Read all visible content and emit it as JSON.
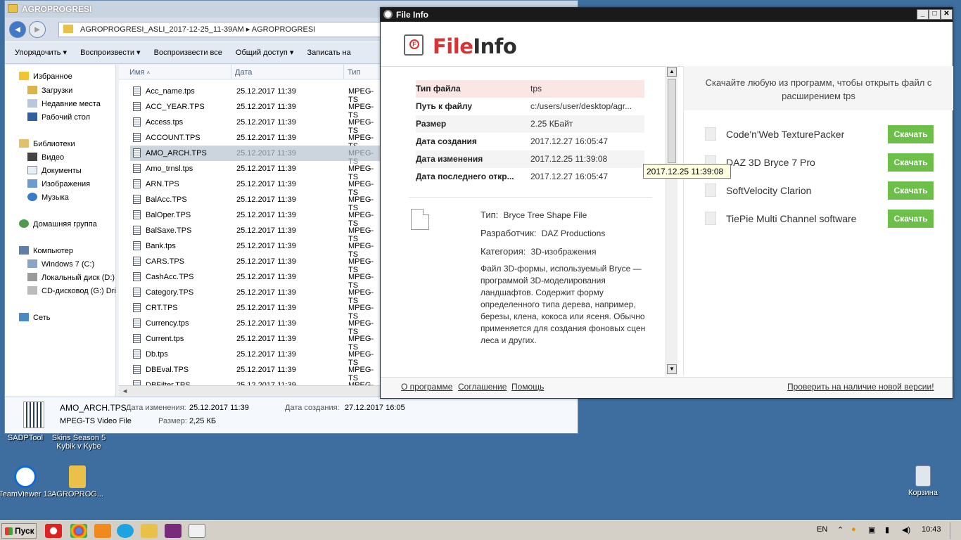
{
  "desktop": {
    "icons": [
      {
        "label": "SADPTool"
      },
      {
        "label": "Skins Season 5 Kybik v Kybe"
      },
      {
        "label": "TeamViewer 13"
      },
      {
        "label": "AGROPROG..."
      },
      {
        "label": "Корзина"
      }
    ]
  },
  "explorer": {
    "title": "AGROPROGRESI",
    "breadcrumb": "AGROPROGRESI_ASLI_2017-12-25_11-39AM  ▸  AGROPROGRESI",
    "toolbar": [
      "Упорядочить ▾",
      "Воспроизвести ▾",
      "Воспроизвести все",
      "Общий доступ ▾",
      "Записать на"
    ],
    "nav": {
      "favorites": "Избранное",
      "downloads": "Загрузки",
      "recent": "Недавние места",
      "desktop": "Рабочий стол",
      "libraries": "Библиотеки",
      "video": "Видео",
      "documents": "Документы",
      "images": "Изображения",
      "music": "Музыка",
      "homegroup": "Домашняя группа",
      "computer": "Компьютер",
      "drive_c": "Windows 7 (C:)",
      "drive_d": "Локальный диск (D:)",
      "drive_g": "CD-дисковод (G:) Dri",
      "network": "Сеть"
    },
    "columns": {
      "name": "Имя",
      "date": "Дата",
      "type": "Тип"
    },
    "files": [
      {
        "name": "Acc_name.tps",
        "date": "25.12.2017 11:39",
        "type": "MPEG-TS"
      },
      {
        "name": "ACC_YEAR.TPS",
        "date": "25.12.2017 11:39",
        "type": "MPEG-TS"
      },
      {
        "name": "Access.tps",
        "date": "25.12.2017 11:39",
        "type": "MPEG-TS"
      },
      {
        "name": "ACCOUNT.TPS",
        "date": "25.12.2017 11:39",
        "type": "MPEG-TS"
      },
      {
        "name": "AMO_ARCH.TPS",
        "date": "25.12.2017 11:39",
        "type": "MPEG-TS"
      },
      {
        "name": "Amo_trnsl.tps",
        "date": "25.12.2017 11:39",
        "type": "MPEG-TS"
      },
      {
        "name": "ARN.TPS",
        "date": "25.12.2017 11:39",
        "type": "MPEG-TS"
      },
      {
        "name": "BalAcc.TPS",
        "date": "25.12.2017 11:39",
        "type": "MPEG-TS"
      },
      {
        "name": "BalOper.TPS",
        "date": "25.12.2017 11:39",
        "type": "MPEG-TS"
      },
      {
        "name": "BalSaxe.TPS",
        "date": "25.12.2017 11:39",
        "type": "MPEG-TS"
      },
      {
        "name": "Bank.tps",
        "date": "25.12.2017 11:39",
        "type": "MPEG-TS"
      },
      {
        "name": "CARS.TPS",
        "date": "25.12.2017 11:39",
        "type": "MPEG-TS"
      },
      {
        "name": "CashAcc.TPS",
        "date": "25.12.2017 11:39",
        "type": "MPEG-TS"
      },
      {
        "name": "Category.TPS",
        "date": "25.12.2017 11:39",
        "type": "MPEG-TS"
      },
      {
        "name": "CRT.TPS",
        "date": "25.12.2017 11:39",
        "type": "MPEG-TS"
      },
      {
        "name": "Currency.tps",
        "date": "25.12.2017 11:39",
        "type": "MPEG-TS"
      },
      {
        "name": "Current.tps",
        "date": "25.12.2017 11:39",
        "type": "MPEG-TS"
      },
      {
        "name": "Db.tps",
        "date": "25.12.2017 11:39",
        "type": "MPEG-TS"
      },
      {
        "name": "DBEval.TPS",
        "date": "25.12.2017 11:39",
        "type": "MPEG-TS"
      },
      {
        "name": "DBFilter.TPS",
        "date": "25.12.2017 11:39",
        "type": "MPEG-TS"
      }
    ],
    "details": {
      "name": "AMO_ARCH.TPS",
      "type": "MPEG-TS Video File",
      "modified_label": "Дата изменения:",
      "modified": "25.12.2017 11:39",
      "created_label": "Дата создания:",
      "created": "27.12.2017 16:05",
      "size_label": "Размер:",
      "size": "2,25 КБ"
    }
  },
  "fileinfo": {
    "window_title": "File Info",
    "brand_a": "File",
    "brand_b": "Info",
    "props": [
      {
        "k": "Тип файла",
        "v": "tps"
      },
      {
        "k": "Путь к файлу",
        "v": "c:/users/user/desktop/agr..."
      },
      {
        "k": "Размер",
        "v": "2.25 КБайт"
      },
      {
        "k": "Дата создания",
        "v": "2017.12.27 16:05:47"
      },
      {
        "k": "Дата изменения",
        "v": "2017.12.25 11:39:08"
      },
      {
        "k": "Дата последнего откр...",
        "v": "2017.12.27 16:05:47"
      }
    ],
    "type_label": "Тип:",
    "type_value": "Bryce Tree Shape File",
    "dev_label": "Разработчик:",
    "dev_value": "DAZ Productions",
    "cat_label": "Категория:",
    "cat_value": "3D-изображения",
    "description": "Файл 3D-формы, используемый Bryce — программой 3D-моделирования ландшафтов. Содержит форму определенного типа дерева, например, березы, клена, кокоса или ясеня. Обычно применяется для создания фоновых сцен леса и других.",
    "right_header": "Скачайте любую из программ, чтобы открыть файл с расширением tps",
    "programs": [
      {
        "name": "Code'n'Web TexturePacker",
        "button": "Скачать"
      },
      {
        "name": "DAZ 3D Bryce 7 Pro",
        "button": "Скачать"
      },
      {
        "name": "SoftVelocity Clarion",
        "button": "Скачать"
      },
      {
        "name": "TiePie Multi Channel software",
        "button": "Скачать"
      }
    ],
    "footer": {
      "about": "О программе",
      "agreement": "Соглашение",
      "help": "Помощь",
      "check": "Проверить на наличие новой версии!"
    },
    "tooltip": "2017.12.25 11:39:08"
  },
  "taskbar": {
    "start": "Пуск",
    "lang": "EN",
    "clock": "10:43"
  }
}
